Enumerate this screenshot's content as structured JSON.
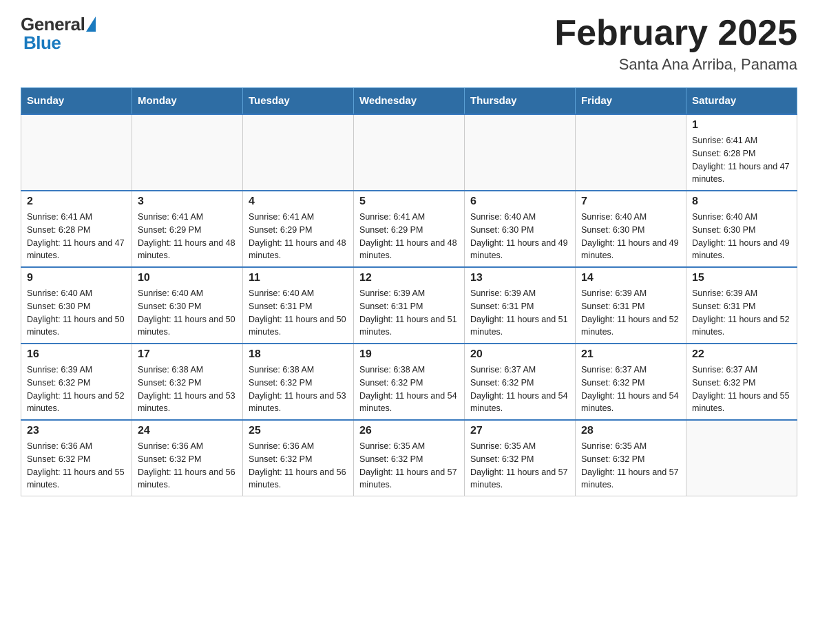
{
  "header": {
    "logo_general": "General",
    "logo_blue": "Blue",
    "month_title": "February 2025",
    "location": "Santa Ana Arriba, Panama"
  },
  "days_of_week": [
    "Sunday",
    "Monday",
    "Tuesday",
    "Wednesday",
    "Thursday",
    "Friday",
    "Saturday"
  ],
  "weeks": [
    [
      {
        "day": "",
        "info": ""
      },
      {
        "day": "",
        "info": ""
      },
      {
        "day": "",
        "info": ""
      },
      {
        "day": "",
        "info": ""
      },
      {
        "day": "",
        "info": ""
      },
      {
        "day": "",
        "info": ""
      },
      {
        "day": "1",
        "info": "Sunrise: 6:41 AM\nSunset: 6:28 PM\nDaylight: 11 hours and 47 minutes."
      }
    ],
    [
      {
        "day": "2",
        "info": "Sunrise: 6:41 AM\nSunset: 6:28 PM\nDaylight: 11 hours and 47 minutes."
      },
      {
        "day": "3",
        "info": "Sunrise: 6:41 AM\nSunset: 6:29 PM\nDaylight: 11 hours and 48 minutes."
      },
      {
        "day": "4",
        "info": "Sunrise: 6:41 AM\nSunset: 6:29 PM\nDaylight: 11 hours and 48 minutes."
      },
      {
        "day": "5",
        "info": "Sunrise: 6:41 AM\nSunset: 6:29 PM\nDaylight: 11 hours and 48 minutes."
      },
      {
        "day": "6",
        "info": "Sunrise: 6:40 AM\nSunset: 6:30 PM\nDaylight: 11 hours and 49 minutes."
      },
      {
        "day": "7",
        "info": "Sunrise: 6:40 AM\nSunset: 6:30 PM\nDaylight: 11 hours and 49 minutes."
      },
      {
        "day": "8",
        "info": "Sunrise: 6:40 AM\nSunset: 6:30 PM\nDaylight: 11 hours and 49 minutes."
      }
    ],
    [
      {
        "day": "9",
        "info": "Sunrise: 6:40 AM\nSunset: 6:30 PM\nDaylight: 11 hours and 50 minutes."
      },
      {
        "day": "10",
        "info": "Sunrise: 6:40 AM\nSunset: 6:30 PM\nDaylight: 11 hours and 50 minutes."
      },
      {
        "day": "11",
        "info": "Sunrise: 6:40 AM\nSunset: 6:31 PM\nDaylight: 11 hours and 50 minutes."
      },
      {
        "day": "12",
        "info": "Sunrise: 6:39 AM\nSunset: 6:31 PM\nDaylight: 11 hours and 51 minutes."
      },
      {
        "day": "13",
        "info": "Sunrise: 6:39 AM\nSunset: 6:31 PM\nDaylight: 11 hours and 51 minutes."
      },
      {
        "day": "14",
        "info": "Sunrise: 6:39 AM\nSunset: 6:31 PM\nDaylight: 11 hours and 52 minutes."
      },
      {
        "day": "15",
        "info": "Sunrise: 6:39 AM\nSunset: 6:31 PM\nDaylight: 11 hours and 52 minutes."
      }
    ],
    [
      {
        "day": "16",
        "info": "Sunrise: 6:39 AM\nSunset: 6:32 PM\nDaylight: 11 hours and 52 minutes."
      },
      {
        "day": "17",
        "info": "Sunrise: 6:38 AM\nSunset: 6:32 PM\nDaylight: 11 hours and 53 minutes."
      },
      {
        "day": "18",
        "info": "Sunrise: 6:38 AM\nSunset: 6:32 PM\nDaylight: 11 hours and 53 minutes."
      },
      {
        "day": "19",
        "info": "Sunrise: 6:38 AM\nSunset: 6:32 PM\nDaylight: 11 hours and 54 minutes."
      },
      {
        "day": "20",
        "info": "Sunrise: 6:37 AM\nSunset: 6:32 PM\nDaylight: 11 hours and 54 minutes."
      },
      {
        "day": "21",
        "info": "Sunrise: 6:37 AM\nSunset: 6:32 PM\nDaylight: 11 hours and 54 minutes."
      },
      {
        "day": "22",
        "info": "Sunrise: 6:37 AM\nSunset: 6:32 PM\nDaylight: 11 hours and 55 minutes."
      }
    ],
    [
      {
        "day": "23",
        "info": "Sunrise: 6:36 AM\nSunset: 6:32 PM\nDaylight: 11 hours and 55 minutes."
      },
      {
        "day": "24",
        "info": "Sunrise: 6:36 AM\nSunset: 6:32 PM\nDaylight: 11 hours and 56 minutes."
      },
      {
        "day": "25",
        "info": "Sunrise: 6:36 AM\nSunset: 6:32 PM\nDaylight: 11 hours and 56 minutes."
      },
      {
        "day": "26",
        "info": "Sunrise: 6:35 AM\nSunset: 6:32 PM\nDaylight: 11 hours and 57 minutes."
      },
      {
        "day": "27",
        "info": "Sunrise: 6:35 AM\nSunset: 6:32 PM\nDaylight: 11 hours and 57 minutes."
      },
      {
        "day": "28",
        "info": "Sunrise: 6:35 AM\nSunset: 6:32 PM\nDaylight: 11 hours and 57 minutes."
      },
      {
        "day": "",
        "info": ""
      }
    ]
  ]
}
